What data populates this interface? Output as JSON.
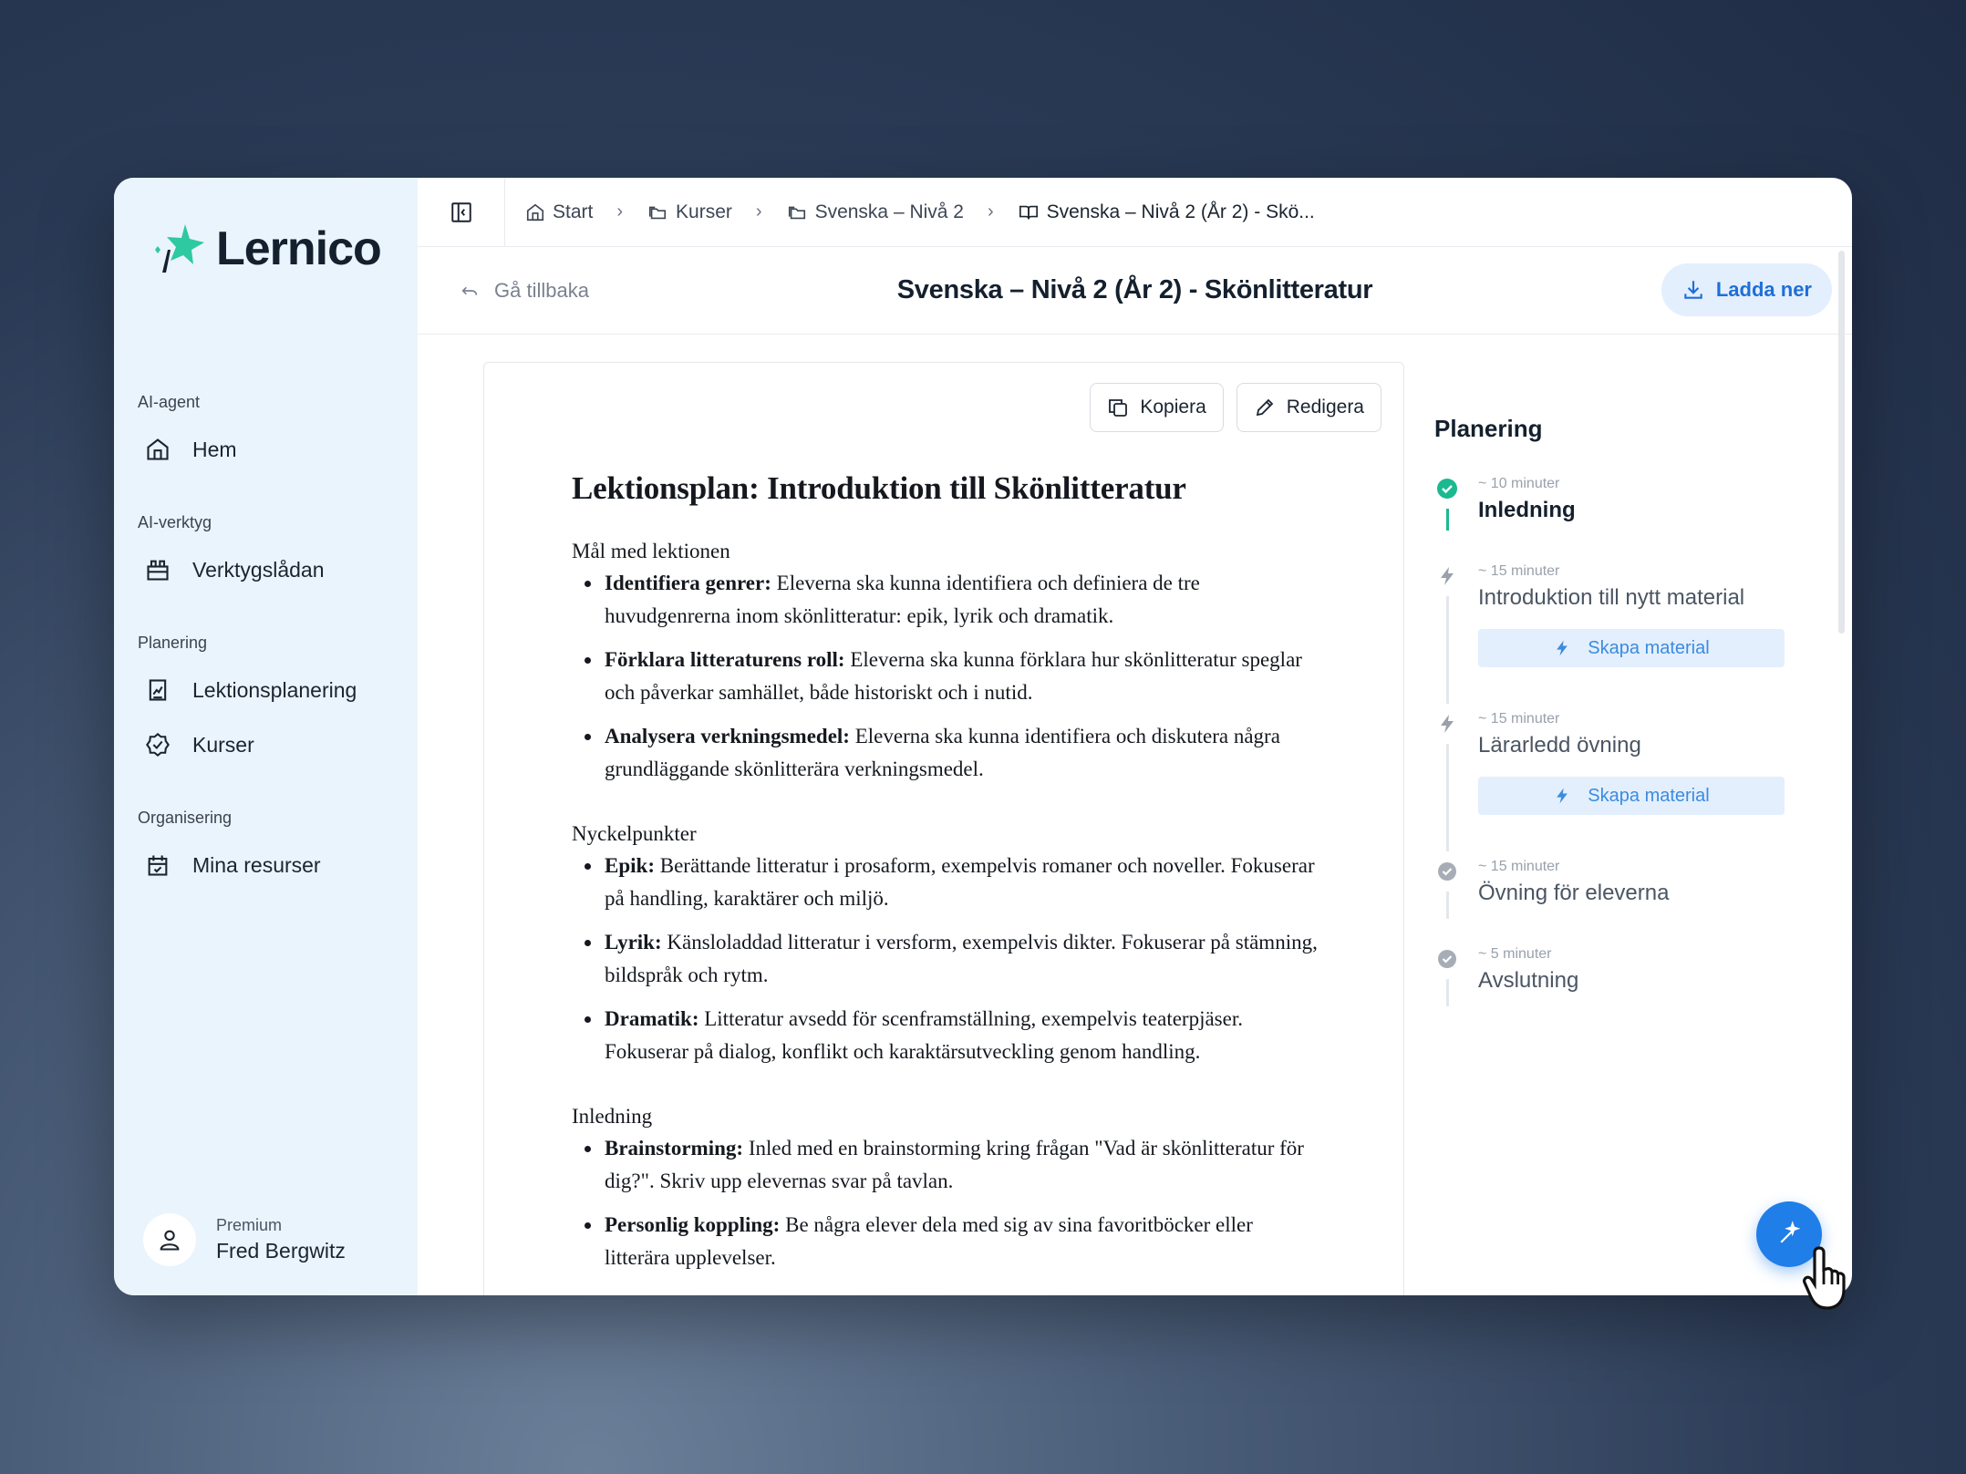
{
  "app": {
    "name": "Lernico"
  },
  "sidebar": {
    "sections": [
      {
        "label": "AI-agent",
        "items": [
          {
            "label": "Hem",
            "icon": "home-icon"
          }
        ]
      },
      {
        "label": "AI-verktyg",
        "items": [
          {
            "label": "Verktygslådan",
            "icon": "toolbox-icon"
          }
        ]
      },
      {
        "label": "Planering",
        "items": [
          {
            "label": "Lektionsplanering",
            "icon": "clipboard-icon"
          },
          {
            "label": "Kurser",
            "icon": "badge-check-icon"
          }
        ]
      },
      {
        "label": "Organisering",
        "items": [
          {
            "label": "Mina resurser",
            "icon": "calendar-icon"
          }
        ]
      }
    ],
    "user": {
      "plan": "Premium",
      "name": "Fred Bergwitz"
    }
  },
  "breadcrumb": [
    {
      "label": "Start",
      "icon": "home-icon"
    },
    {
      "label": "Kurser",
      "icon": "folder-icon"
    },
    {
      "label": "Svenska – Nivå 2",
      "icon": "folder-icon"
    },
    {
      "label": "Svenska – Nivå 2 (År 2) - Skö...",
      "icon": "book-icon"
    }
  ],
  "header": {
    "back_label": "Gå tillbaka",
    "title": "Svenska – Nivå 2 (År 2) - Skönlitteratur",
    "download_label": "Ladda ner"
  },
  "document": {
    "copy_label": "Kopiera",
    "edit_label": "Redigera",
    "title": "Lektionsplan: Introduktion till Skönlitteratur",
    "sections": [
      {
        "heading": "Mål med lektionen",
        "items": [
          {
            "bold": "Identifiera genrer:",
            "text": " Eleverna ska kunna identifiera och definiera de tre huvudgenrerna inom skönlitteratur: epik, lyrik och dramatik."
          },
          {
            "bold": "Förklara litteraturens roll:",
            "text": " Eleverna ska kunna förklara hur skönlitteratur speglar och påverkar samhället, både historiskt och i nutid."
          },
          {
            "bold": "Analysera verkningsmedel:",
            "text": " Eleverna ska kunna identifiera och diskutera några grundläggande skönlitterära verkningsmedel."
          }
        ]
      },
      {
        "heading": "Nyckelpunkter",
        "items": [
          {
            "bold": "Epik:",
            "text": " Berättande litteratur i prosaform, exempelvis romaner och noveller. Fokuserar på handling, karaktärer och miljö."
          },
          {
            "bold": "Lyrik:",
            "text": " Känsloladdad litteratur i versform, exempelvis dikter. Fokuserar på stämning, bildspråk och rytm."
          },
          {
            "bold": "Dramatik:",
            "text": " Litteratur avsedd för scenframställning, exempelvis teaterpjäser. Fokuserar på dialog, konflikt och karaktärsutveckling genom handling."
          }
        ]
      },
      {
        "heading": "Inledning",
        "items": [
          {
            "bold": "Brainstorming:",
            "text": " Inled med en brainstorming kring frågan \"Vad är skönlitteratur för dig?\". Skriv upp elevernas svar på tavlan."
          },
          {
            "bold": "Personlig koppling:",
            "text": " Be några elever dela med sig av sina favoritböcker eller litterära upplevelser."
          }
        ]
      }
    ]
  },
  "planning": {
    "title": "Planering",
    "material_label": "Skapa material",
    "steps": [
      {
        "duration": "~ 10 minuter",
        "title": "Inledning",
        "status": "done"
      },
      {
        "duration": "~ 15 minuter",
        "title": "Introduktion till nytt material",
        "status": "material"
      },
      {
        "duration": "~ 15 minuter",
        "title": "Lärarledd övning",
        "status": "material"
      },
      {
        "duration": "~ 15 minuter",
        "title": "Övning för eleverna",
        "status": "pending"
      },
      {
        "duration": "~ 5 minuter",
        "title": "Avslutning",
        "status": "pending"
      }
    ]
  },
  "colors": {
    "accent": "#1f7ee8",
    "success": "#1bb98f",
    "sidebar_bg": "#eaf4fd"
  }
}
